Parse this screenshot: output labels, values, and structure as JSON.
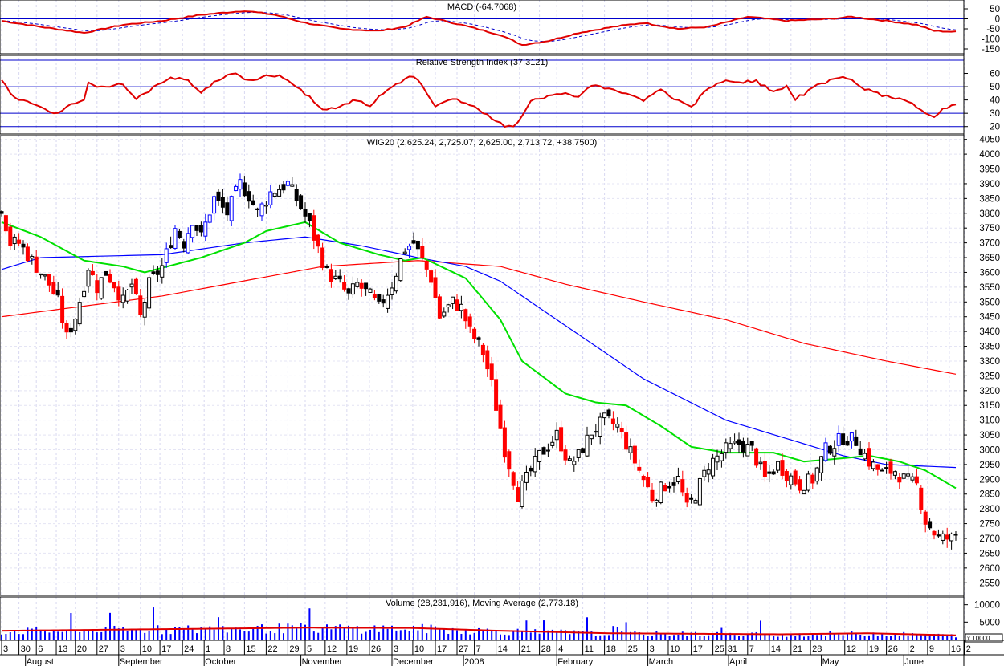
{
  "chart_data": {
    "type": "candlestick",
    "symbol": "WIG20",
    "panels": {
      "macd": {
        "title": "MACD (-64.7068)",
        "ticks": [
          50,
          0,
          -50,
          -100,
          -150
        ],
        "ylim": [
          -170,
          90
        ],
        "macd": [
          [
            0,
            -10
          ],
          [
            9,
            -40
          ],
          [
            19,
            -70
          ],
          [
            28,
            -30
          ],
          [
            37,
            -10
          ],
          [
            46,
            20
          ],
          [
            56,
            40
          ],
          [
            63,
            20
          ],
          [
            70,
            -20
          ],
          [
            78,
            -50
          ],
          [
            87,
            -60
          ],
          [
            93,
            -40
          ],
          [
            98,
            10
          ],
          [
            106,
            -30
          ],
          [
            115,
            -80
          ],
          [
            120,
            -130
          ],
          [
            126,
            -110
          ],
          [
            133,
            -70
          ],
          [
            141,
            -40
          ],
          [
            148,
            -20
          ],
          [
            156,
            -50
          ],
          [
            163,
            -40
          ],
          [
            172,
            10
          ],
          [
            181,
            -10
          ],
          [
            191,
            0
          ],
          [
            196,
            10
          ],
          [
            204,
            -10
          ],
          [
            211,
            -30
          ],
          [
            215,
            -60
          ],
          [
            220,
            -65
          ]
        ]
      },
      "rsi": {
        "title": "Relative Strength Index (37.3121)",
        "ticks": [
          60,
          50,
          40,
          30,
          20
        ],
        "levels": [
          70,
          50,
          30,
          20
        ],
        "ylim": [
          15,
          73
        ],
        "values": [
          [
            0,
            55
          ],
          [
            3,
            42
          ],
          [
            7,
            38
          ],
          [
            12,
            30
          ],
          [
            15,
            35
          ],
          [
            19,
            40
          ],
          [
            20,
            52
          ],
          [
            24,
            50
          ],
          [
            28,
            53
          ],
          [
            31,
            40
          ],
          [
            35,
            50
          ],
          [
            39,
            57
          ],
          [
            43,
            55
          ],
          [
            46,
            45
          ],
          [
            50,
            55
          ],
          [
            54,
            60
          ],
          [
            57,
            55
          ],
          [
            61,
            58
          ],
          [
            65,
            57
          ],
          [
            69,
            48
          ],
          [
            74,
            32
          ],
          [
            78,
            35
          ],
          [
            81,
            40
          ],
          [
            85,
            35
          ],
          [
            87,
            43
          ],
          [
            91,
            52
          ],
          [
            94,
            58
          ],
          [
            96,
            55
          ],
          [
            100,
            35
          ],
          [
            104,
            42
          ],
          [
            107,
            38
          ],
          [
            111,
            30
          ],
          [
            116,
            20
          ],
          [
            119,
            22
          ],
          [
            122,
            40
          ],
          [
            128,
            45
          ],
          [
            133,
            42
          ],
          [
            136,
            52
          ],
          [
            141,
            48
          ],
          [
            144,
            45
          ],
          [
            148,
            40
          ],
          [
            152,
            48
          ],
          [
            156,
            40
          ],
          [
            159,
            35
          ],
          [
            163,
            50
          ],
          [
            167,
            55
          ],
          [
            170,
            52
          ],
          [
            174,
            55
          ],
          [
            178,
            45
          ],
          [
            181,
            50
          ],
          [
            183,
            40
          ],
          [
            187,
            50
          ],
          [
            191,
            55
          ],
          [
            194,
            58
          ],
          [
            198,
            50
          ],
          [
            202,
            45
          ],
          [
            206,
            42
          ],
          [
            209,
            40
          ],
          [
            213,
            30
          ],
          [
            215,
            27
          ],
          [
            218,
            35
          ],
          [
            220,
            37
          ]
        ]
      },
      "price": {
        "title": "WIG20 (2,625.24, 2,725.07, 2,625.00, 2,713.72, +38.7500)",
        "ylim": [
          2510,
          4060
        ],
        "tick_start": 2550,
        "tick_end": 4050,
        "tick_step": 50,
        "close": [
          [
            0,
            3820
          ],
          [
            2,
            3700
          ],
          [
            4,
            3700
          ],
          [
            8,
            3620
          ],
          [
            11,
            3560
          ],
          [
            13,
            3500
          ],
          [
            15,
            3380
          ],
          [
            17,
            3450
          ],
          [
            19,
            3560
          ],
          [
            20,
            3620
          ],
          [
            22,
            3550
          ],
          [
            24,
            3600
          ],
          [
            26,
            3560
          ],
          [
            28,
            3500
          ],
          [
            30,
            3560
          ],
          [
            32,
            3450
          ],
          [
            34,
            3560
          ],
          [
            37,
            3620
          ],
          [
            40,
            3750
          ],
          [
            42,
            3700
          ],
          [
            44,
            3780
          ],
          [
            46,
            3720
          ],
          [
            49,
            3850
          ],
          [
            52,
            3800
          ],
          [
            55,
            3900
          ],
          [
            57,
            3860
          ],
          [
            59,
            3800
          ],
          [
            62,
            3870
          ],
          [
            66,
            3900
          ],
          [
            69,
            3820
          ],
          [
            71,
            3760
          ],
          [
            73,
            3680
          ],
          [
            75,
            3600
          ],
          [
            78,
            3560
          ],
          [
            80,
            3520
          ],
          [
            82,
            3560
          ],
          [
            85,
            3520
          ],
          [
            87,
            3480
          ],
          [
            90,
            3560
          ],
          [
            93,
            3680
          ],
          [
            95,
            3700
          ],
          [
            97,
            3640
          ],
          [
            99,
            3580
          ],
          [
            101,
            3450
          ],
          [
            104,
            3500
          ],
          [
            106,
            3480
          ],
          [
            108,
            3400
          ],
          [
            111,
            3330
          ],
          [
            113,
            3220
          ],
          [
            116,
            3000
          ],
          [
            118,
            2900
          ],
          [
            119,
            2850
          ],
          [
            121,
            2900
          ],
          [
            124,
            2980
          ],
          [
            128,
            3050
          ],
          [
            131,
            2950
          ],
          [
            133,
            2980
          ],
          [
            136,
            3060
          ],
          [
            139,
            3100
          ],
          [
            142,
            3080
          ],
          [
            144,
            3020
          ],
          [
            147,
            2930
          ],
          [
            150,
            2840
          ],
          [
            153,
            2880
          ],
          [
            156,
            2900
          ],
          [
            158,
            2800
          ],
          [
            160,
            2850
          ],
          [
            163,
            2950
          ],
          [
            167,
            3000
          ],
          [
            170,
            3020
          ],
          [
            173,
            3000
          ],
          [
            176,
            2900
          ],
          [
            179,
            2950
          ],
          [
            181,
            2920
          ],
          [
            184,
            2880
          ],
          [
            187,
            2900
          ],
          [
            190,
            3000
          ],
          [
            194,
            3040
          ],
          [
            197,
            3030
          ],
          [
            200,
            2960
          ],
          [
            203,
            2920
          ],
          [
            206,
            2930
          ],
          [
            208,
            2900
          ],
          [
            211,
            2880
          ],
          [
            213,
            2760
          ],
          [
            216,
            2700
          ],
          [
            219,
            2700
          ],
          [
            220,
            2714
          ]
        ],
        "ma_short": [
          [
            0,
            3770
          ],
          [
            9,
            3720
          ],
          [
            19,
            3640
          ],
          [
            28,
            3620
          ],
          [
            33,
            3600
          ],
          [
            46,
            3650
          ],
          [
            56,
            3700
          ],
          [
            61,
            3740
          ],
          [
            70,
            3770
          ],
          [
            78,
            3700
          ],
          [
            87,
            3660
          ],
          [
            93,
            3640
          ],
          [
            97,
            3650
          ],
          [
            107,
            3580
          ],
          [
            115,
            3440
          ],
          [
            120,
            3300
          ],
          [
            130,
            3190
          ],
          [
            137,
            3160
          ],
          [
            144,
            3150
          ],
          [
            152,
            3080
          ],
          [
            159,
            3010
          ],
          [
            167,
            2990
          ],
          [
            178,
            2990
          ],
          [
            185,
            2960
          ],
          [
            193,
            2970
          ],
          [
            200,
            2980
          ],
          [
            207,
            2960
          ],
          [
            213,
            2930
          ],
          [
            220,
            2870
          ]
        ],
        "ma_medium": [
          [
            0,
            3610
          ],
          [
            9,
            3650
          ],
          [
            37,
            3660
          ],
          [
            56,
            3700
          ],
          [
            70,
            3720
          ],
          [
            83,
            3690
          ],
          [
            96,
            3650
          ],
          [
            107,
            3620
          ],
          [
            115,
            3570
          ],
          [
            130,
            3420
          ],
          [
            148,
            3240
          ],
          [
            167,
            3100
          ],
          [
            185,
            3020
          ],
          [
            194,
            2980
          ],
          [
            204,
            2950
          ],
          [
            220,
            2940
          ]
        ],
        "ma_long": [
          [
            0,
            3450
          ],
          [
            37,
            3520
          ],
          [
            74,
            3620
          ],
          [
            96,
            3640
          ],
          [
            115,
            3620
          ],
          [
            130,
            3560
          ],
          [
            148,
            3500
          ],
          [
            167,
            3440
          ],
          [
            185,
            3360
          ],
          [
            204,
            3300
          ],
          [
            222,
            3250
          ]
        ]
      },
      "volume": {
        "title": "Volume (28,231,916), Moving Average (2,773.18)",
        "ticks": [
          10000,
          5000
        ],
        "ylim": [
          0,
          12000
        ],
        "unit_label": "x 10000",
        "ma": [
          [
            0,
            2500
          ],
          [
            40,
            3000
          ],
          [
            70,
            3400
          ],
          [
            95,
            3300
          ],
          [
            115,
            2500
          ],
          [
            140,
            1800
          ],
          [
            180,
            1500
          ],
          [
            200,
            1800
          ],
          [
            220,
            1200
          ]
        ]
      }
    },
    "x_axis": {
      "day_ticks": [
        [
          "3",
          0
        ],
        [
          "30",
          4
        ],
        [
          "6",
          8
        ],
        [
          "13",
          12.6
        ],
        [
          "20",
          17
        ],
        [
          "27",
          22
        ],
        [
          "3",
          27
        ],
        [
          "10",
          32
        ],
        [
          "17",
          36.5
        ],
        [
          "24",
          41.7
        ],
        [
          "1",
          46.7
        ],
        [
          "8",
          51.3
        ],
        [
          "15",
          56
        ],
        [
          "22",
          61
        ],
        [
          "29",
          66
        ],
        [
          "5",
          70
        ],
        [
          "12",
          74.6
        ],
        [
          "19",
          79.6
        ],
        [
          "26",
          84.8
        ],
        [
          "3",
          90
        ],
        [
          "10",
          94.8
        ],
        [
          "17",
          100
        ],
        [
          "27",
          105
        ],
        [
          "7",
          109
        ],
        [
          "14",
          114
        ],
        [
          "21",
          119.4
        ],
        [
          "28",
          124
        ],
        [
          "4",
          128
        ],
        [
          "11",
          134
        ],
        [
          "18",
          139
        ],
        [
          "25",
          144
        ],
        [
          "3",
          149
        ],
        [
          "10",
          153.7
        ],
        [
          "17",
          159
        ],
        [
          "25",
          164
        ],
        [
          "31",
          167
        ],
        [
          "7",
          172
        ],
        [
          "14",
          177
        ],
        [
          "21",
          182
        ],
        [
          "28",
          186.5
        ],
        [
          "12",
          194.4
        ],
        [
          "19",
          199.6
        ],
        [
          "26",
          204
        ],
        [
          "2",
          209
        ],
        [
          "9",
          213.5
        ],
        [
          "16",
          218.5
        ],
        [
          "2",
          222
        ]
      ],
      "months": [
        [
          "August",
          5.5
        ],
        [
          "September",
          27
        ],
        [
          "October",
          46.7
        ],
        [
          "November",
          69
        ],
        [
          "December",
          90
        ],
        [
          "2008",
          106.5
        ],
        [
          "February",
          128
        ],
        [
          "March",
          149
        ],
        [
          "April",
          167.6
        ],
        [
          "May",
          189
        ],
        [
          "June",
          208
        ]
      ]
    },
    "colors": {
      "macd": "#e00000",
      "signal": "#0000cc",
      "rsi": "#e00000",
      "ma_short": "#00e000",
      "ma_medium": "#0000ff",
      "ma_long": "#ff0000",
      "volume": "#0000ff",
      "volume_ma": "#e00000",
      "down": "#ff0000",
      "up_strong": "#0000ff"
    }
  }
}
